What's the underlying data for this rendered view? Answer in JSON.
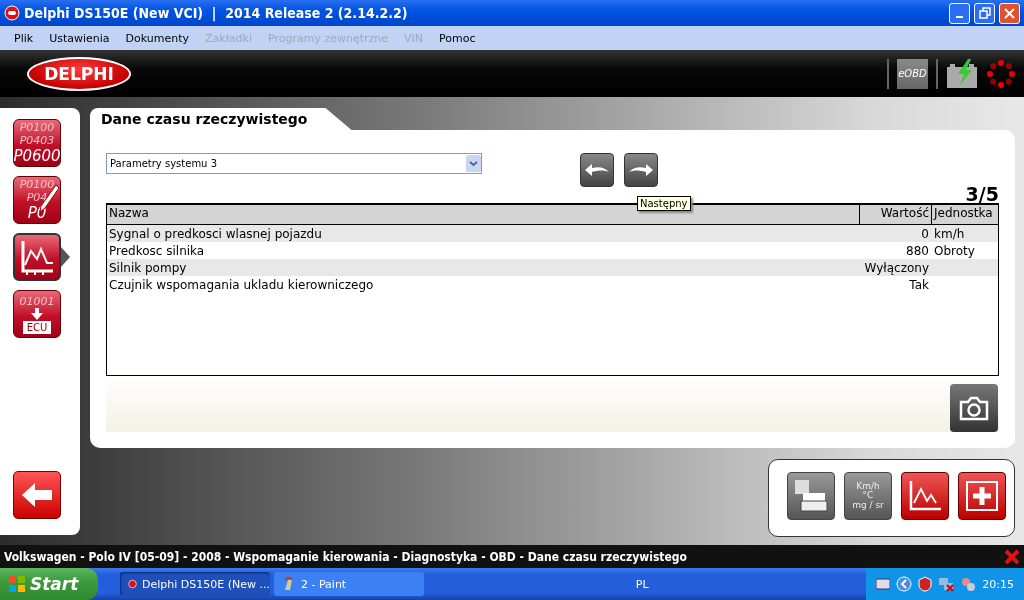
{
  "window": {
    "title": "Delphi DS150E (New VCI)  |  2014 Release 2 (2.14.2.2)"
  },
  "menu": [
    {
      "label": "Plik",
      "disabled": false
    },
    {
      "label": "Ustawienia",
      "disabled": false
    },
    {
      "label": "Dokumenty",
      "disabled": false
    },
    {
      "label": "Zakładki",
      "disabled": true
    },
    {
      "label": "Programy zewnętrzne",
      "disabled": true
    },
    {
      "label": "VIN",
      "disabled": true
    },
    {
      "label": "Pomoc",
      "disabled": false
    }
  ],
  "header": {
    "logo": "DELPHI",
    "badge": "eOBD"
  },
  "sidebar": {
    "items": [
      {
        "kind": "codes",
        "lines": [
          "P0100",
          "P0403",
          "P0600"
        ],
        "selected": false
      },
      {
        "kind": "erase",
        "lines": [
          "P0100",
          "P04",
          "P0"
        ],
        "selected": false
      },
      {
        "kind": "live",
        "selected": true
      },
      {
        "kind": "ecu",
        "lines": [
          "01001",
          "ECU"
        ],
        "selected": false
      }
    ]
  },
  "panel": {
    "tab": "Dane czasu rzeczywistego",
    "dropdown": {
      "value": "Parametry systemu 3"
    },
    "page": "3/5",
    "tooltip": "Następny",
    "table": {
      "columns": [
        "Nazwa",
        "Wartość",
        "Jednostka"
      ],
      "rows": [
        {
          "name": "Sygnal o predkosci wlasnej pojazdu",
          "value": "0",
          "unit": "km/h"
        },
        {
          "name": "Predkosc silnika",
          "value": "880",
          "unit": "Obroty"
        },
        {
          "name": "Silnik pompy",
          "value": "Wyłączony",
          "unit": ""
        },
        {
          "name": "Czujnik wspomagania ukladu kierowniczego",
          "value": "Tak",
          "unit": ""
        }
      ]
    }
  },
  "toolbar": [
    {
      "kind": "print"
    },
    {
      "kind": "units",
      "lines": [
        "Km/h",
        "°C",
        "mg / sr"
      ]
    },
    {
      "kind": "graph"
    },
    {
      "kind": "add"
    }
  ],
  "breadcrumb": "Volkswagen - Polo IV [05-09] - 2008 - Wspomaganie kierowania - Diagnostyka - OBD - Dane czasu rzeczywistego",
  "taskbar": {
    "start": "Start",
    "tasks": [
      {
        "label": "Delphi DS150E (New ...",
        "selected": true
      },
      {
        "label": "2 - Paint",
        "selected": false
      }
    ],
    "language": "PL",
    "clock": "20:15"
  }
}
